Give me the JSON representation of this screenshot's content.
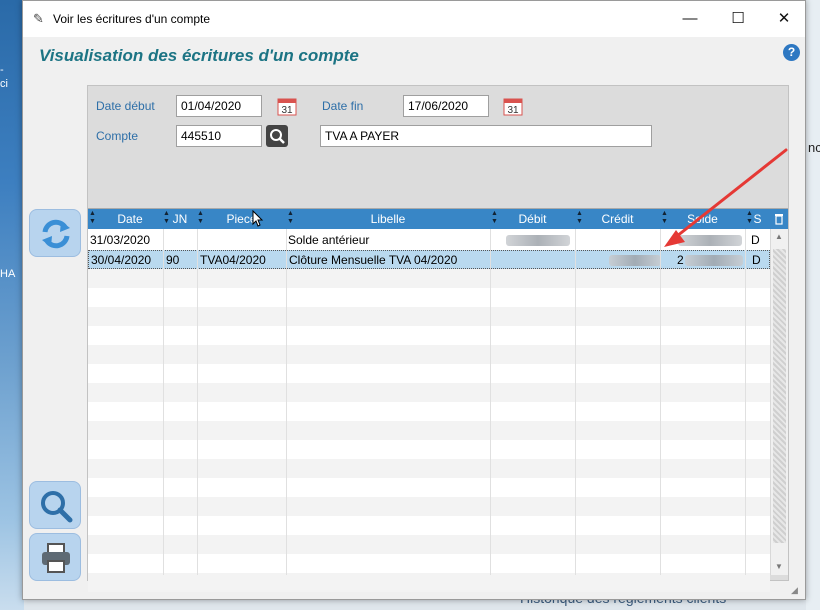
{
  "window": {
    "title": "Voir les écritures d'un compte",
    "minimize": "—",
    "maximize": "☐",
    "close": "✕"
  },
  "heading": "Visualisation des écritures d'un compte",
  "help": "?",
  "form": {
    "date_debut_label": "Date début",
    "date_debut_value": "01/04/2020",
    "date_fin_label": "Date fin",
    "date_fin_value": "17/06/2020",
    "compte_label": "Compte",
    "compte_value": "445510",
    "compte_libelle": "TVA A PAYER",
    "calendar_day": "31"
  },
  "grid": {
    "columns": [
      "Date",
      "JN",
      "Piece",
      "Libelle",
      "Débit",
      "Crédit",
      "Solde",
      "S"
    ],
    "rows": [
      {
        "date": "31/03/2020",
        "jn": "",
        "piece": "",
        "libelle": "Solde antérieur",
        "debit": "",
        "credit": "",
        "solde": "",
        "s": "D"
      },
      {
        "date": "30/04/2020",
        "jn": "90",
        "piece": "TVA04/2020",
        "libelle": "Clôture Mensuelle TVA 04/2020",
        "debit": "",
        "credit": "",
        "solde": "2",
        "s": "D"
      }
    ]
  },
  "desktop": {
    "left_text_1": "-",
    "left_text_2": "ci",
    "left_text_3": "HA",
    "right_text": "nc",
    "bottom_text": "Historique des règlements clients"
  },
  "colors": {
    "accent": "#1c7484",
    "header": "#3886c6",
    "selected_row": "#b9d9ef",
    "arrow": "#e53935"
  }
}
